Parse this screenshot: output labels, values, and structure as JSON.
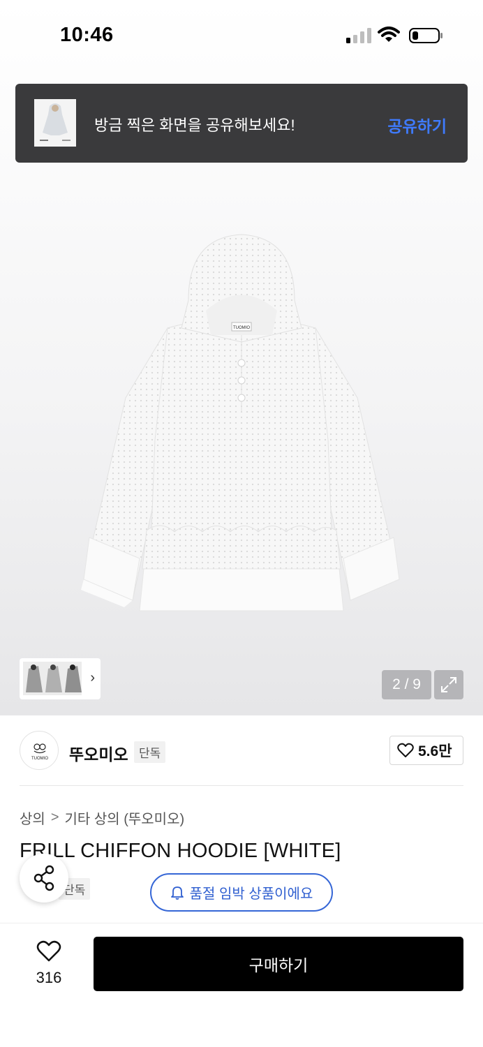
{
  "status_bar": {
    "time": "10:46"
  },
  "toast": {
    "message": "방금 찍은 화면을 공유해보세요!",
    "action": "공유하기"
  },
  "gallery": {
    "counter": "2 / 9",
    "thumb_next": "›"
  },
  "brand": {
    "name": "뚜오미오",
    "badge": "단독",
    "logo_text": "TUOMIO",
    "likes": "5.6만"
  },
  "breadcrumb": {
    "level1": "상의",
    "separator": ">",
    "level2": "기타 상의 (뚜오미오)"
  },
  "product": {
    "title": "FRILL CHIFFON HOODIE [WHITE]",
    "badge": "단독",
    "label_text": "TUOMIO"
  },
  "notice": {
    "soldout_soon": "품절 임박 상품이에요"
  },
  "bottom_bar": {
    "wish_count": "316",
    "buy_label": "구매하기"
  },
  "colors": {
    "accent_blue": "#3566d6",
    "toast_bg": "#3a3a3c",
    "toast_action": "#3f7bff",
    "buy_bg": "#000000"
  }
}
